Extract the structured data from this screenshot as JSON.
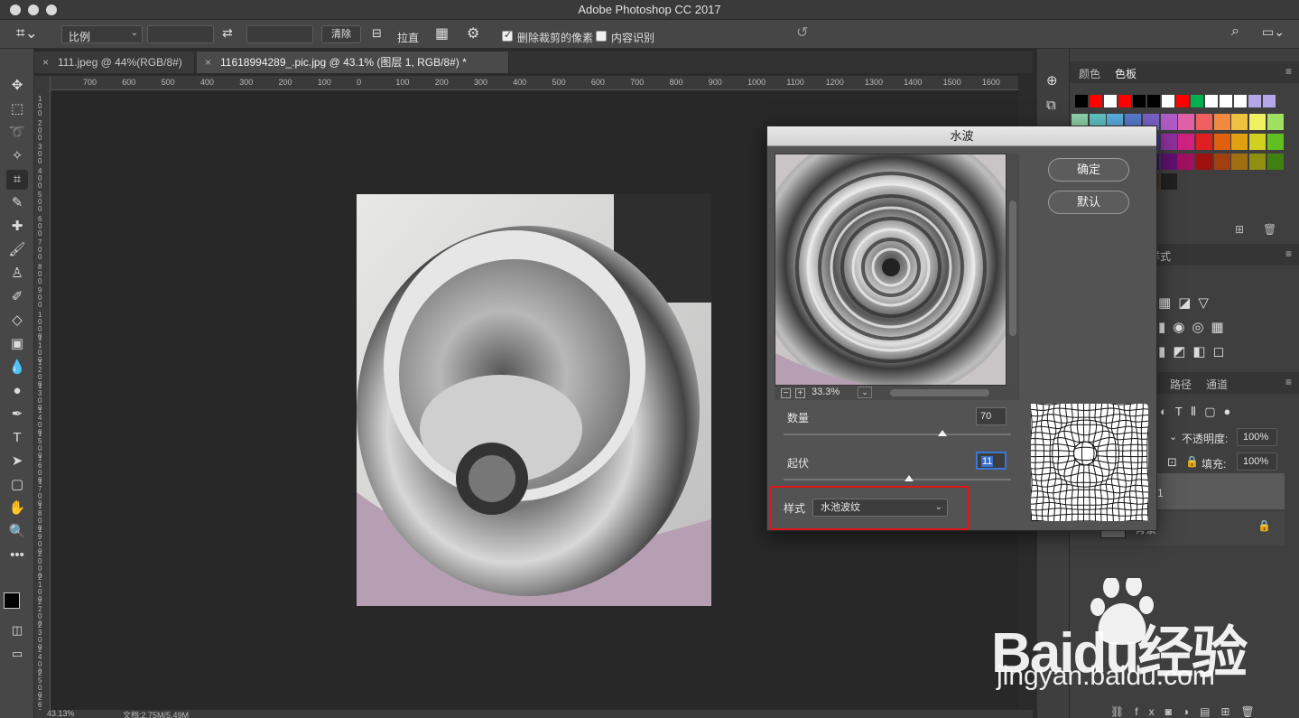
{
  "app": {
    "title": "Adobe Photoshop CC 2017"
  },
  "options_bar": {
    "ratio_value": "比例",
    "clear_label": "清除",
    "straighten_label": "拉直",
    "delete_cropped_label": "删除裁剪的像素",
    "delete_cropped_checked": true,
    "content_aware_label": "内容识别",
    "content_aware_checked": false
  },
  "tabs": [
    {
      "label": "111.jpeg @ 44%(RGB/8#)",
      "active": false
    },
    {
      "label": "11618994289_.pic.jpg @ 43.1% (图层 1, RGB/8#) *",
      "active": true
    }
  ],
  "ruler": {
    "h_ticks": [
      "700",
      "600",
      "500",
      "400",
      "300",
      "200",
      "100",
      "0",
      "100",
      "200",
      "300",
      "400",
      "500",
      "600",
      "700",
      "800",
      "900",
      "1000",
      "1100",
      "1200",
      "1300",
      "1400",
      "1500",
      "1600"
    ],
    "v_ticks": [
      "100",
      "200",
      "300",
      "400",
      "500",
      "600",
      "700",
      "800",
      "900",
      "1000",
      "1100",
      "1200",
      "1300",
      "1400",
      "1500",
      "1600",
      "1700",
      "1800",
      "1900",
      "2000",
      "2100",
      "2200",
      "2300",
      "2400",
      "2500",
      "2600"
    ]
  },
  "status": {
    "zoom": "43.13%",
    "doc": "文档:2.75M/5.49M"
  },
  "panels": {
    "top_tabs": [
      "颜色",
      "色板"
    ],
    "adjust_partial_label": "样式",
    "layers_tabs": [
      "路径",
      "通道"
    ],
    "opacity_label": "不透明度:",
    "opacity_value": "100%",
    "fill_label": "填充:",
    "fill_value": "100%",
    "layer1_partial": "1",
    "bg_layer_name": "背景"
  },
  "dialog": {
    "title": "水波",
    "ok_label": "确定",
    "default_label": "默认",
    "zoom": "33.3%",
    "amount_label": "数量",
    "amount_value": "70",
    "amount_max": 100,
    "ridges_label": "起伏",
    "ridges_value": "11",
    "ridges_max": 20,
    "style_label": "样式",
    "style_value": "水池波纹"
  },
  "watermark": {
    "brand": "Baidu经验",
    "url": "jingyan.baidu.com"
  },
  "colors": {
    "highlight": "#e0161b",
    "focus": "#3a77d6",
    "swatches_row1": [
      "#000000",
      "#ff0000",
      "#ffffff",
      "#ff0000",
      "#000000",
      "#000000",
      "#ffffff",
      "#ff0000",
      "#00b050",
      "#ffffff",
      "#ffffff",
      "#ffffff",
      "#b4a7e8",
      "#b4a7e8"
    ]
  }
}
